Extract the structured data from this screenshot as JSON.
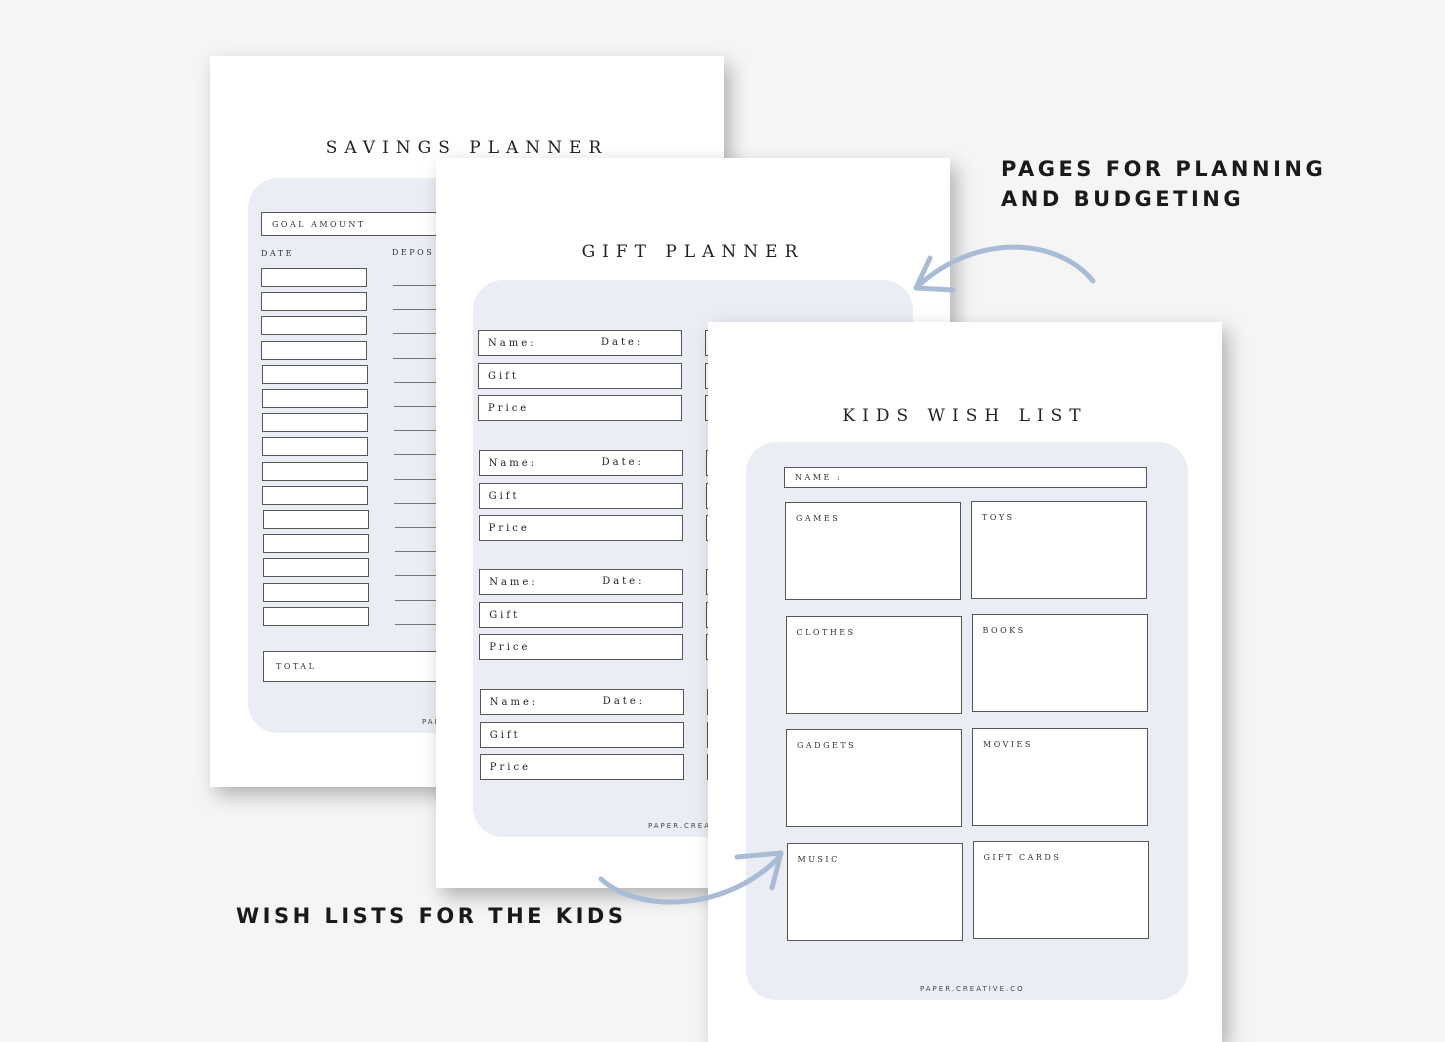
{
  "captions": {
    "planning_line1": "PAGES FOR PLANNING",
    "planning_line2": "AND BUDGETING",
    "wishlists": "WISH LISTS FOR THE KIDS"
  },
  "arrow_color": "#a9bcd6",
  "panel_color": "#eaeef4",
  "savings_planner": {
    "title": "SAVINGS PLANNER",
    "goal_label": "GOAL AMOUNT",
    "date_header": "DATE",
    "deposit_header": "DEPOS",
    "row_count": 15,
    "total_label": "TOTAL",
    "footer": "PAP"
  },
  "gift_planner": {
    "title": "GIFT PLANNER",
    "name_label": "Name:",
    "date_label": "Date:",
    "gift_label": "Gift",
    "price_label": "Price",
    "group_count": 4,
    "footer": "PAPER.CREAT"
  },
  "kids_wish_list": {
    "title": "KIDS WISH LIST",
    "name_label": "NAME :",
    "categories": [
      "GAMES",
      "TOYS",
      "CLOTHES",
      "BOOKS",
      "GADGETS",
      "MOVIES",
      "MUSIC",
      "GIFT CARDS"
    ],
    "footer": "PAPER.CREATIVE.CO"
  }
}
